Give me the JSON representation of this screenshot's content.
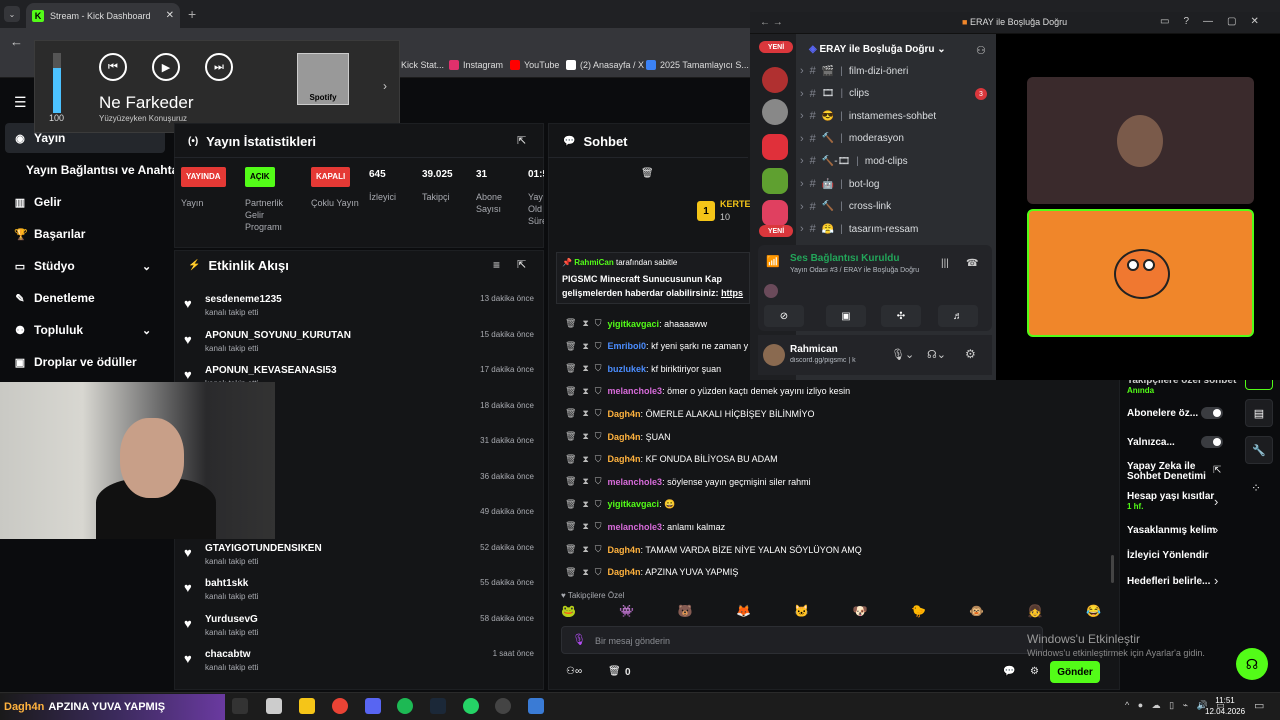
{
  "browser": {
    "tab_title": "Stream - Kick Dashboard",
    "tab_close": "✕",
    "newtab": "+",
    "menu": "⌄",
    "bookmarks": [
      {
        "label": "Kick Stat...",
        "color": "#53fc18"
      },
      {
        "label": "Instagram",
        "color": "#e1306c"
      },
      {
        "label": "YouTube",
        "color": "#ff0000"
      },
      {
        "label": "(2) Anasayfa / X",
        "color": "#ffffff"
      },
      {
        "label": "2025 Tamamlayıcı S...",
        "color": "#3b82f6"
      }
    ]
  },
  "media": {
    "volume": "100",
    "volume_level": 0.75,
    "song": "Ne Farkeder",
    "artist": "Yüzyüzeyken Konuşuruz",
    "provider": "Spotify",
    "prev": "⏮",
    "play": "▶",
    "next": "⏭",
    "chevron": "›"
  },
  "sidebar": {
    "items": [
      {
        "icon": "◉",
        "label": "Yayın"
      },
      {
        "icon": "",
        "label": "Yayın Bağlantısı ve Anahtarı"
      },
      {
        "icon": "▥",
        "label": "Gelir"
      },
      {
        "icon": "🏆",
        "label": "Başarılar"
      },
      {
        "icon": "▭",
        "label": "Stüdyo",
        "chev": "⌄"
      },
      {
        "icon": "✎",
        "label": "Denetleme"
      },
      {
        "icon": "⚉",
        "label": "Topluluk",
        "chev": "⌄"
      },
      {
        "icon": "▣",
        "label": "Droplar ve ödüller"
      }
    ]
  },
  "stats": {
    "title": "Yayın İstatistikleri",
    "icon": "(•)",
    "expand": "⇱",
    "cells": [
      {
        "badge": "YAYINDA",
        "badge_color": "#e53935",
        "label": "Yayın"
      },
      {
        "badge": "AÇIK",
        "badge_color": "#53fc18",
        "label": "Partnerlik Gelir Programı"
      },
      {
        "badge": "KAPALI",
        "badge_color": "#e53935",
        "label": "Çoklu Yayın"
      },
      {
        "value": "645",
        "label": "İzleyici"
      },
      {
        "value": "39.025",
        "label": "Takipçi"
      },
      {
        "value": "31",
        "label": "Abone Sayısı"
      },
      {
        "value": "01:5",
        "label": "Yay Old Süre"
      }
    ]
  },
  "activity": {
    "title": "Etkinlik Akışı",
    "icon": "⚡",
    "filter": "≡",
    "expand": "⇱",
    "items": [
      {
        "name": "sesdeneme1235",
        "sub": "kanalı takip etti",
        "time": "13 dakika önce"
      },
      {
        "name": "APONUN_SOYUNU_KURUTAN",
        "sub": "kanalı takip etti",
        "time": "15 dakika önce"
      },
      {
        "name": "APONUN_KEVASEANASI53",
        "sub": "kanalı takip etti",
        "time": "17 dakika önce"
      },
      {
        "name": "",
        "sub": "",
        "time": "18 dakika önce"
      },
      {
        "name": "",
        "sub": "",
        "time": "31 dakika önce"
      },
      {
        "name": "",
        "sub": "",
        "time": "36 dakika önce"
      },
      {
        "name": "",
        "sub": "",
        "time": "49 dakika önce"
      },
      {
        "name": "GTAYIGOTUNDENSIKEN",
        "sub": "kanalı takip etti",
        "time": "52 dakika önce"
      },
      {
        "name": "baht1skk",
        "sub": "kanalı takip etti",
        "time": "55 dakika önce"
      },
      {
        "name": "YurdusevG",
        "sub": "kanalı takip etti",
        "time": "58 dakika önce"
      },
      {
        "name": "chacabtw",
        "sub": "kanalı takip etti",
        "time": "1 saat önce"
      }
    ]
  },
  "chat": {
    "title": "Sohbet",
    "icon": "💬",
    "trash": "🗑",
    "pinned_by": "RahmiCan",
    "pinned_suffix": "tarafından sabitle",
    "pinned_text": "PIGSMC Minecraft Sunucusunun Kap",
    "pinned_text2": "gelişmelerden haberdar olabilirsiniz:",
    "pinned_link": "https",
    "kerte": "KERTE",
    "kerte_num": "10",
    "rank": "1",
    "messages": [
      {
        "user": "yigitkavgaci",
        "color": "#53fc18",
        "text": "ahaaaaww"
      },
      {
        "user": "Emriboi0",
        "color": "#4b8dff",
        "text": "kf yeni şarkı ne zaman y"
      },
      {
        "user": "buzlukek",
        "color": "#4b8dff",
        "text": "kf biriktiriyor şuan"
      },
      {
        "user": "melanchole3",
        "color": "#d66bd9",
        "text": "ömer o yüzden kaçtı demek yayını izliyo kesin"
      },
      {
        "user": "Dagh4n",
        "color": "#ffb23e",
        "text": "ÖMERLE ALAKALI HİÇBİŞEY BİLİNMİYO"
      },
      {
        "user": "Dagh4n",
        "color": "#ffb23e",
        "text": "ŞUAN"
      },
      {
        "user": "Dagh4n",
        "color": "#ffb23e",
        "text": "KF ONUDA BİLİYOSA BU ADAM"
      },
      {
        "user": "melanchole3",
        "color": "#d66bd9",
        "text": "söylense yayın geçmişini siler rahmi"
      },
      {
        "user": "yigitkavgaci",
        "color": "#53fc18",
        "text": "😀"
      },
      {
        "user": "melanchole3",
        "color": "#d66bd9",
        "text": "anlamı kalmaz"
      },
      {
        "user": "Dagh4n",
        "color": "#ffb23e",
        "text": "TAMAM VARDA BİZE NİYE YALAN SÖYLÜYON AMQ"
      },
      {
        "user": "Dagh4n",
        "color": "#ffb23e",
        "text": "APZINA YUVA YAPMIŞ"
      }
    ],
    "followers_only": "Takipçilere Özel",
    "placeholder": "Bir mesaj gönderin",
    "send": "Gönder",
    "count": "0"
  },
  "settings": {
    "items": [
      {
        "label": "Takipçilere özel sohbet",
        "sub": "Anında"
      },
      {
        "label": "Abonelere öz..."
      },
      {
        "label": "Yalnızca..."
      },
      {
        "label": "Yapay Zeka ile Sohbet Denetimi"
      },
      {
        "label": "Hesap yaşı kısıtlar",
        "sub": "1 hf."
      },
      {
        "label": "Yasaklanmış kelim"
      },
      {
        "label": "İzleyici Yönlendir"
      },
      {
        "label": "Hedefleri belirle..."
      }
    ]
  },
  "discord": {
    "window_title": "ERAY ile Boşluğa Doğru",
    "server_name": "ERAY ile Boşluğa Doğru",
    "new_badge": "YENİ",
    "channels": [
      {
        "name": "film-dizi-öneri",
        "emoji": "🎬",
        "badge": ""
      },
      {
        "name": "clips",
        "emoji": "🎞",
        "badge": "3"
      },
      {
        "name": "instamemes-sohbet",
        "emoji": "😎",
        "badge": ""
      },
      {
        "name": "moderasyon",
        "emoji": "🔨",
        "badge": ""
      },
      {
        "name": "mod-clips",
        "emoji": "🔨-🎞",
        "badge": ""
      },
      {
        "name": "bot-log",
        "emoji": "🤖",
        "badge": ""
      },
      {
        "name": "cross-link",
        "emoji": "🔨",
        "badge": ""
      },
      {
        "name": "tasarım-ressam",
        "emoji": "😤",
        "badge": ""
      }
    ],
    "voice_status": "Ses Bağlantısı Kuruldu",
    "voice_channel": "Yayın Odası #3 / ERAY ile Boşluğa Doğru",
    "user": "Rahmican",
    "user_status": "discord.gg/pigsmc | k"
  },
  "taskbar": {
    "overlay_text": "APZINA YUVA YAPMIŞ",
    "overlay_user": "Dagh4n",
    "time": "11:51",
    "date": "12.04.2026"
  },
  "watermark": {
    "title": "Windows'u Etkinleştir",
    "sub": "Windows'u etkinleştirmek için Ayarlar'a gidin."
  }
}
